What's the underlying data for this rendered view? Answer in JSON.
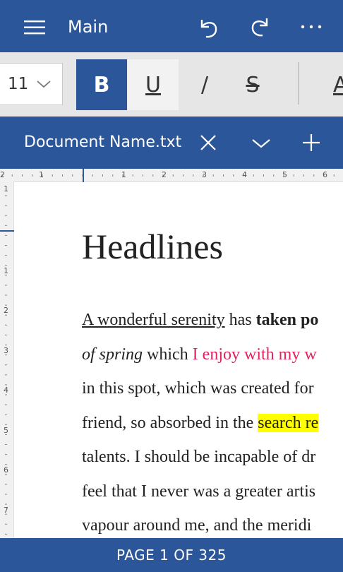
{
  "app": {
    "title": "Main"
  },
  "toolbar": {
    "font_size": "11",
    "bold_label": "B",
    "underline_label": "U",
    "italic_label": "/",
    "strike_label": "S",
    "font_color_label": "A"
  },
  "tab": {
    "document_name": "Document Name.txt"
  },
  "ruler": {
    "horizontal": [
      "2",
      "1",
      "1",
      "2",
      "3",
      "4",
      "5",
      "6"
    ],
    "vertical": [
      "1",
      "1",
      "2",
      "3",
      "4",
      "5",
      "6",
      "7"
    ]
  },
  "document": {
    "heading": "Headlines",
    "lines": [
      [
        {
          "t": "A wonderful serenity",
          "s": "u"
        },
        {
          "t": " has ",
          "s": ""
        },
        {
          "t": "taken po",
          "s": "b"
        }
      ],
      [
        {
          "t": "of spring",
          "s": "i"
        },
        {
          "t": " which ",
          "s": ""
        },
        {
          "t": "I enjoy with my w",
          "s": "red"
        }
      ],
      [
        {
          "t": "in this spot, which was created for",
          "s": ""
        }
      ],
      [
        {
          "t": "friend, so absorbed in the ",
          "s": ""
        },
        {
          "t": "search re",
          "s": "hl"
        }
      ],
      [
        {
          "t": "talents. I should be incapable of dr",
          "s": ""
        }
      ],
      [
        {
          "t": "feel that I never was a greater artis",
          "s": ""
        }
      ],
      [
        {
          "t": "vapour around me, and the meridi",
          "s": ""
        }
      ]
    ]
  },
  "status": {
    "page_label": "PAGE 1 OF 325"
  }
}
